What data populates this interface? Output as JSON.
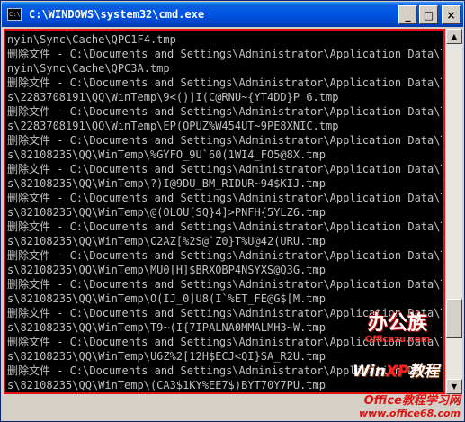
{
  "window": {
    "title": "C:\\WINDOWS\\system32\\cmd.exe",
    "icon_label": "C:\\",
    "minimize_glyph": "_",
    "maximize_glyph": "□",
    "close_glyph": "×"
  },
  "console": {
    "lines": [
      "nyin\\Sync\\Cache\\QPC1F4.tmp",
      "删除文件 - C:\\Documents and Settings\\Administrator\\Application Data\\Tencent\\U",
      "nyin\\Sync\\Cache\\QPC3A.tmp",
      "删除文件 - C:\\Documents and Settings\\Administrator\\Application Data\\Tencent\\U",
      "s\\2283708191\\QQ\\WinTemp\\9<()]I(C@RNU~{YT4DD}P_6.tmp",
      "删除文件 - C:\\Documents and Settings\\Administrator\\Application Data\\Tencent\\U",
      "s\\2283708191\\QQ\\WinTemp\\EP(OPUZ%W454UT~9PE8XNIC.tmp",
      "删除文件 - C:\\Documents and Settings\\Administrator\\Application Data\\Tencent\\U",
      "s\\82108235\\QQ\\WinTemp\\%GYFO_9U`60(1WI4_FO5@8X.tmp",
      "删除文件 - C:\\Documents and Settings\\Administrator\\Application Data\\Tencent\\U",
      "s\\82108235\\QQ\\WinTemp\\?)I@9DU_BM_RIDUR~94$KIJ.tmp",
      "删除文件 - C:\\Documents and Settings\\Administrator\\Application Data\\Tencent\\U",
      "s\\82108235\\QQ\\WinTemp\\@(OLOU[SQ}4]>PNFH{5YLZ6.tmp",
      "删除文件 - C:\\Documents and Settings\\Administrator\\Application Data\\Tencent\\U",
      "s\\82108235\\QQ\\WinTemp\\C2AZ[%2S@`Z0}T%U@42(URU.tmp",
      "删除文件 - C:\\Documents and Settings\\Administrator\\Application Data\\Tencent\\U",
      "s\\82108235\\QQ\\WinTemp\\MU0[H]$BRXOBP4NSYXS@Q3G.tmp",
      "删除文件 - C:\\Documents and Settings\\Administrator\\Application Data\\Tencent\\U",
      "s\\82108235\\QQ\\WinTemp\\O(IJ_0]U8(I`%ET_FE@G$[M.tmp",
      "删除文件 - C:\\Documents and Settings\\Administrator\\Application Data\\Tencent\\U",
      "s\\82108235\\QQ\\WinTemp\\T9~(I{7IPALNA0MMALMH3~W.tmp",
      "删除文件 - C:\\Documents and Settings\\Administrator\\Application Data\\Tencent\\U",
      "s\\82108235\\QQ\\WinTemp\\U6Z%2[12H$ECJ<QI}SA_R2U.tmp",
      "删除文件 - C:\\Documents and Settings\\Administrator\\Application Data\\Tencent\\U",
      "s\\82108235\\QQ\\WinTemp\\(CA3$1KY%EE7$)BYT70Y7PU.tmp"
    ]
  },
  "watermarks": {
    "brand_main": "办公族",
    "brand_sub": "Officezu.com",
    "winxp_prefix": "Win",
    "winxp_xp": "XP",
    "winxp_suffix": "教程",
    "site_title": "Office教程学习网",
    "site_url": "www.office68.com"
  },
  "colors": {
    "console_bg": "#000000",
    "console_fg": "#c0c0c0",
    "titlebar": "#0054e3",
    "highlight_border": "#e01010"
  }
}
